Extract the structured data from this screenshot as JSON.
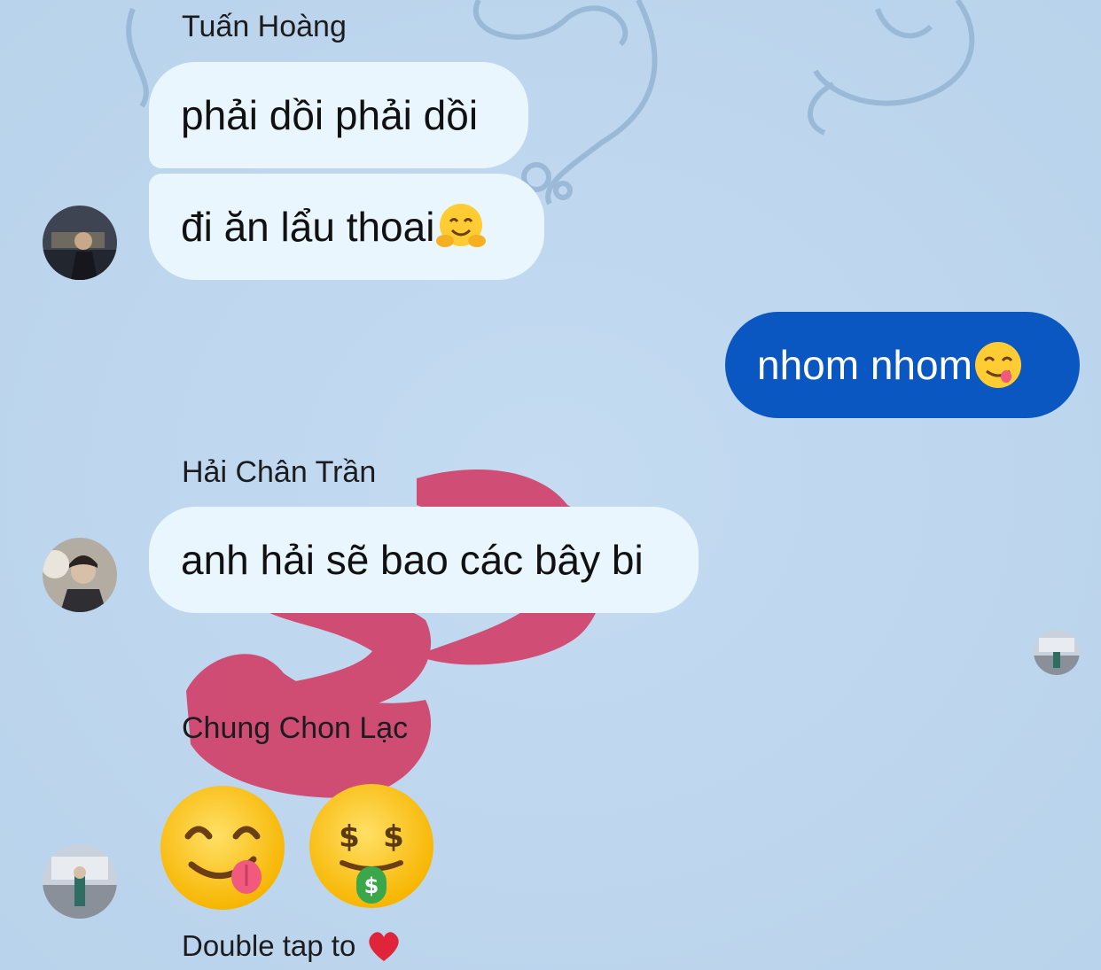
{
  "colors": {
    "background": "#bfd7ef",
    "incoming_bubble": "#eaf6fd",
    "outgoing_bubble": "#0a57c2",
    "lipstick": "#d23a63",
    "ornament": "#8fb0d0"
  },
  "messages": [
    {
      "sender": "Tuấn Hoàng",
      "bubbles": [
        {
          "text": "phải dồi phải dồi",
          "emoji": ""
        },
        {
          "text": "đi ăn lẩu thoai",
          "emoji": "hugging-face-icon"
        }
      ]
    },
    {
      "sender": "",
      "outgoing": true,
      "bubbles": [
        {
          "text": "nhom nhom",
          "emoji": "yum-face-icon"
        }
      ]
    },
    {
      "sender": "Hải Chân Trần",
      "bubbles": [
        {
          "text": "anh hải sẽ bao các bây bi",
          "emoji": ""
        }
      ]
    },
    {
      "sender": "Chung Chon Lạc",
      "emojis": [
        "yum-face-icon",
        "money-mouth-face-icon"
      ]
    }
  ],
  "hint": {
    "text": "Double tap to",
    "icon": "red-heart-icon"
  }
}
